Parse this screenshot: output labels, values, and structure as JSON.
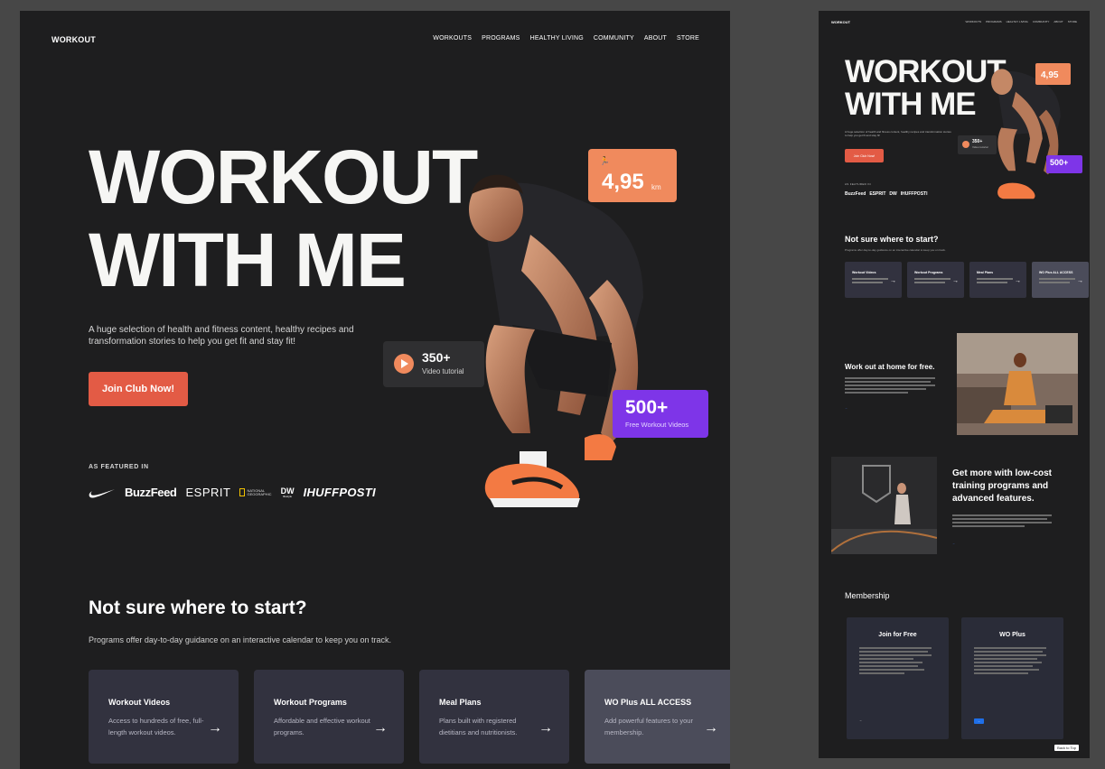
{
  "main": {
    "logo": "WORKOUT",
    "nav": [
      "WORKOUTS",
      "PROGRAMS",
      "HEALTHY LIVING",
      "COMMUNITY",
      "ABOUT",
      "STORE"
    ],
    "hero": {
      "title_line1": "WORKOUT",
      "title_line2": "WITH ME",
      "description": "A huge selection of health and fitness content, healthy recipes and transformation stories to help you get fit and stay fit!",
      "cta": "Join Club Now!"
    },
    "stats": {
      "distance_value": "4,95",
      "distance_unit": "km",
      "videos_value": "350+",
      "videos_label": "Video tutorial",
      "free_value": "500+",
      "free_label": "Free Workout Videos"
    },
    "featured": {
      "label": "AS FEATURED IN",
      "brands": [
        "BuzzFeed",
        "ESPRIT",
        "DW",
        "IHUFFPOSTI"
      ]
    },
    "section": {
      "title": "Not sure where to start?",
      "subtitle": "Programs offer day-to-day guidance on an interactive calendar to keep you on track."
    },
    "cards": [
      {
        "title": "Workout Videos",
        "desc": "Access to hundreds of free, full-length workout videos."
      },
      {
        "title": "Workout Programs",
        "desc": "Affordable and effective workout programs."
      },
      {
        "title": "Meal Plans",
        "desc": "Plans built with registered dietitians and nutritionists."
      },
      {
        "title": "WO Plus ALL ACCESS",
        "desc": "Add powerful features to your membership."
      }
    ]
  },
  "side": {
    "logo": "WORKOUT",
    "nav": [
      "WORKOUTS",
      "PROGRAMS",
      "HEALTHY LIVING",
      "COMMUNITY",
      "ABOUT",
      "STORE"
    ],
    "title_line1": "WORKOUT",
    "title_line2": "WITH ME",
    "distance": "4,95",
    "videos": "350+",
    "free": "500+",
    "cards": [
      "Workout Videos",
      "Workout Programs",
      "Meal Plans",
      "WO Plus ALL ACCESS"
    ],
    "home_heading": "Work out at home for free.",
    "more_heading": "Get more with low-cost training programs and advanced features.",
    "membership": "Membership",
    "plan_free": "Join for Free",
    "plan_plus": "WO Plus",
    "back_to_top": "Back to Top"
  },
  "colors": {
    "background": "#1e1e1f",
    "accent_red": "#e35b45",
    "accent_orange": "#f08a5d",
    "accent_purple": "#7e35e8",
    "card": "#32323f"
  }
}
